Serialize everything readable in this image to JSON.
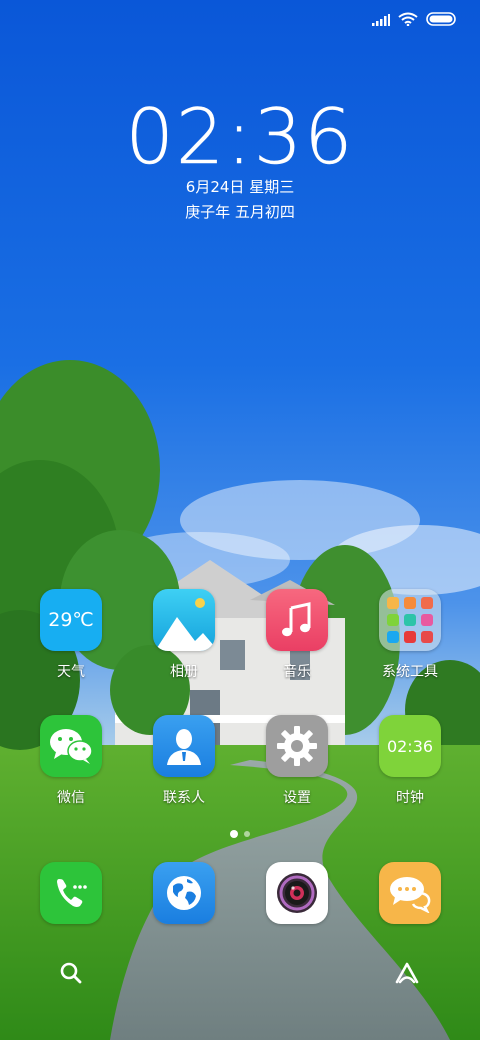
{
  "status_bar": {
    "signal_icon": "signal-icon",
    "wifi_icon": "wifi-icon",
    "battery_icon": "battery-icon"
  },
  "lock_clock": {
    "time": "02:36",
    "date": "6月24日 星期三",
    "lunar": "庚子年 五月初四"
  },
  "home_apps": [
    {
      "label": "天气",
      "icon_text": "29℃",
      "icon": "weather-icon",
      "color": "#1aa8f0"
    },
    {
      "label": "相册",
      "icon": "gallery-icon",
      "color": "#22b8e8"
    },
    {
      "label": "音乐",
      "icon": "music-icon",
      "color": "#f0506e"
    },
    {
      "label": "系统工具",
      "icon": "folder-icon",
      "color": "#b6c4cc"
    },
    {
      "label": "微信",
      "icon": "wechat-icon",
      "color": "#2dc43a"
    },
    {
      "label": "联系人",
      "icon": "contacts-icon",
      "color": "#2b8de8"
    },
    {
      "label": "设置",
      "icon": "settings-icon",
      "color": "#9a9a9a"
    },
    {
      "label": "时钟",
      "icon_text": "02:36",
      "icon": "clock-icon",
      "color": "#7fd33a"
    }
  ],
  "page_indicator": {
    "pages": 2,
    "current": 1
  },
  "dock": [
    {
      "icon": "phone-icon",
      "color": "#2dc43a"
    },
    {
      "icon": "browser-icon",
      "color": "#2b8de8"
    },
    {
      "icon": "camera-icon",
      "color": "#ffffff"
    },
    {
      "icon": "messages-icon",
      "color": "#f7b649"
    }
  ],
  "bottom_bar": {
    "left_icon": "search-icon",
    "right_icon": "assistant-icon"
  }
}
